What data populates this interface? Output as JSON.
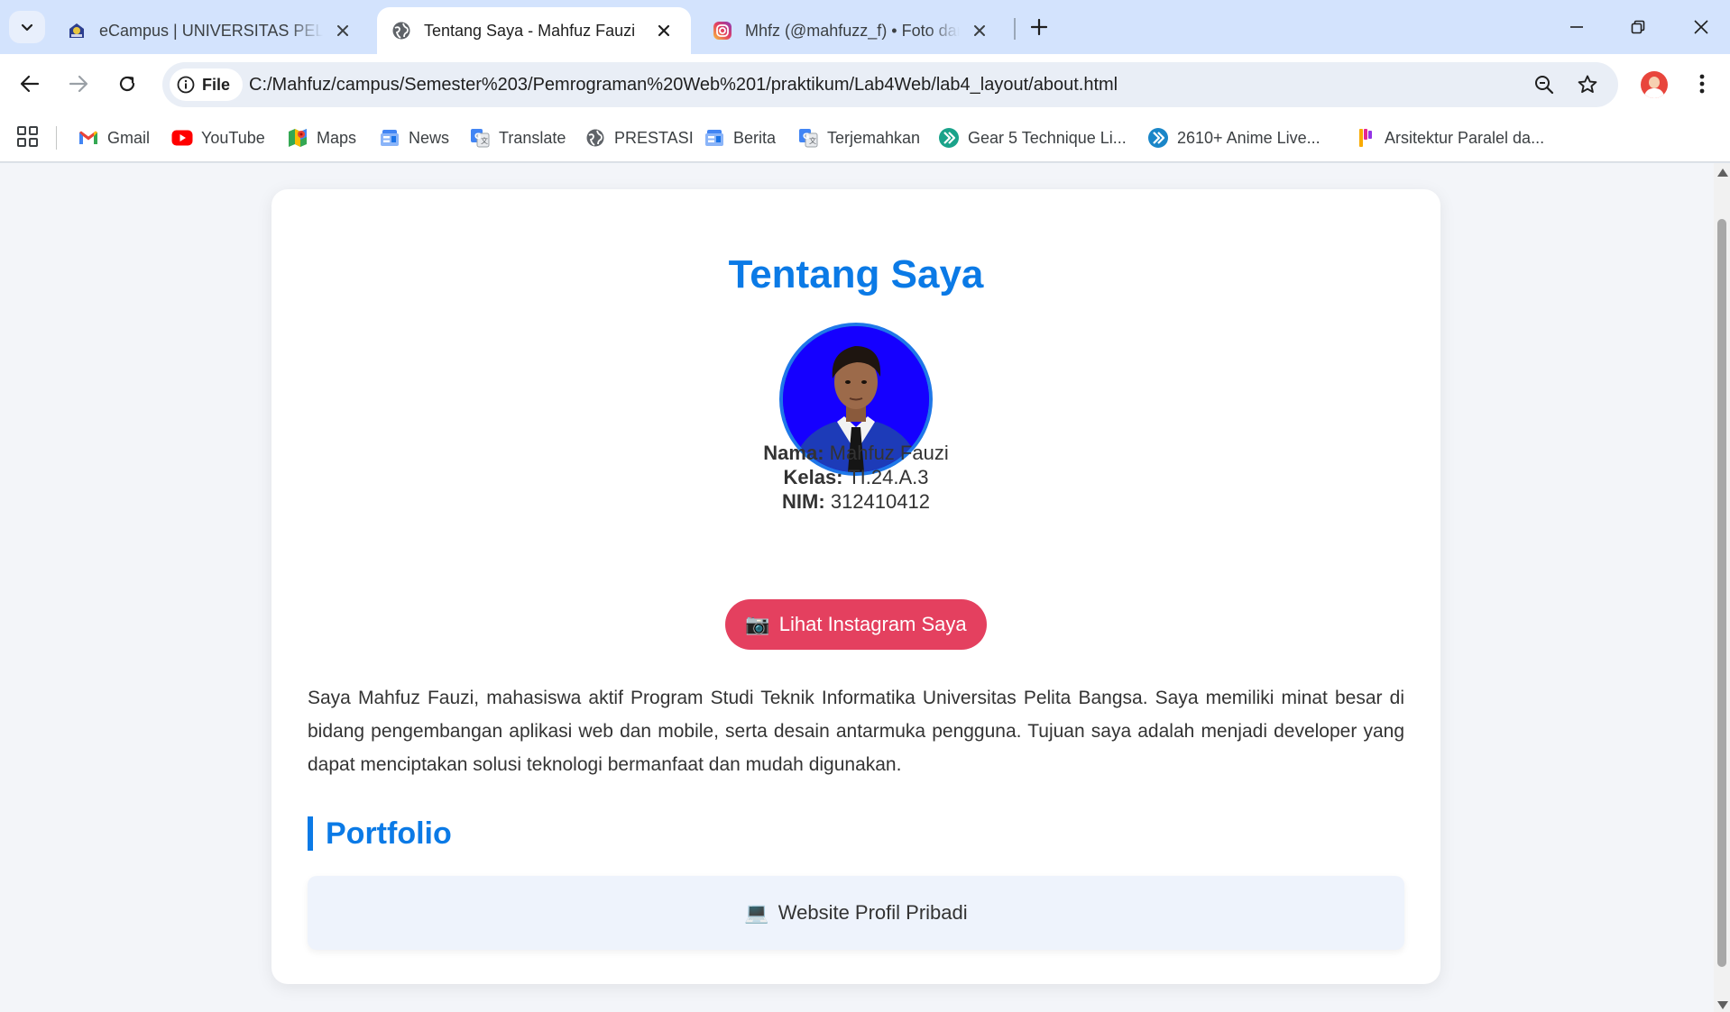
{
  "browser": {
    "tabs": [
      {
        "title": "eCampus | UNIVERSITAS PELITA BANGSA",
        "favicon": "university-logo-icon",
        "active": false
      },
      {
        "title": "Tentang Saya - Mahfuz Fauzi",
        "favicon": "globe-icon",
        "active": true
      },
      {
        "title": "Mhfz (@mahfuzz_f) • Foto dan video Instagram",
        "favicon": "instagram-icon",
        "active": false
      }
    ],
    "address": {
      "scheme_label": "File",
      "url": "C:/Mahfuz/campus/Semester%203/Pemrograman%20Web%201/praktikum/Lab4Web/lab4_layout/about.html"
    },
    "bookmarks": [
      {
        "label": "Gmail",
        "icon": "gmail-icon"
      },
      {
        "label": "YouTube",
        "icon": "youtube-icon"
      },
      {
        "label": "Maps",
        "icon": "maps-icon"
      },
      {
        "label": "News",
        "icon": "news-icon"
      },
      {
        "label": "Translate",
        "icon": "translate-icon"
      },
      {
        "label": "PRESTASI",
        "icon": "globe-icon"
      },
      {
        "label": "Berita",
        "icon": "news-icon"
      },
      {
        "label": "Terjemahkan",
        "icon": "translate-icon"
      },
      {
        "label": "Gear 5 Technique Li...",
        "icon": "arrow-badge-icon"
      },
      {
        "label": "2610+ Anime Live...",
        "icon": "arrow-badge-icon"
      },
      {
        "label": "Arsitektur Paralel da...",
        "icon": "colorful-p-icon"
      }
    ]
  },
  "page": {
    "title": "Tentang Saya",
    "profile": {
      "name_label": "Nama:",
      "name_value": "Mahfuz Fauzi",
      "class_label": "Kelas:",
      "class_value": "TI.24.A.3",
      "nim_label": "NIM:",
      "nim_value": "312410412"
    },
    "instagram_button": {
      "emoji": "📷",
      "label": "Lihat Instagram Saya"
    },
    "about_text": "Saya Mahfuz Fauzi, mahasiswa aktif Program Studi Teknik Informatika Universitas Pelita Bangsa. Saya memiliki minat besar di bidang pengembangan aplikasi web dan mobile, serta desain antarmuka pengguna. Tujuan saya adalah menjadi developer yang dapat menciptakan solusi teknologi bermanfaat dan mudah digunakan.",
    "portfolio": {
      "title": "Portfolio",
      "items": [
        {
          "emoji": "💻",
          "label": "Website Profil Pribadi"
        }
      ]
    }
  },
  "colors": {
    "accent": "#0b7ae6",
    "instagram_button": "#e4405f",
    "avatar_background": "#1500ff",
    "page_background": "#f3f5f9",
    "tabbar": "#d3e3fd"
  }
}
